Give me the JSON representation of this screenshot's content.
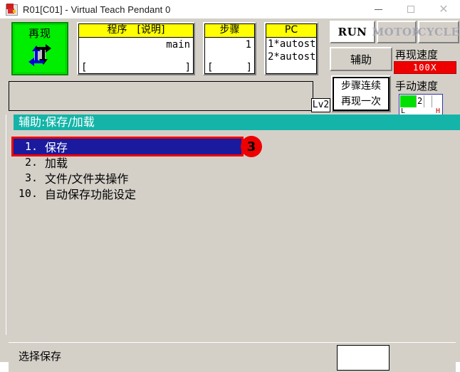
{
  "window": {
    "title": "R01[C01] - Virtual Teach Pendant 0",
    "icon": "app-icon",
    "minimize": "—",
    "maximize": "",
    "close": "✕"
  },
  "mode_button": {
    "label": "再现",
    "icon": "cycle-arrows-icon",
    "color": "#00ee00"
  },
  "panels": [
    {
      "name": "program",
      "header": "程序　[说明]",
      "value": "main",
      "bracket_left": "[",
      "bracket_right": "]"
    },
    {
      "name": "step",
      "header": "步骤",
      "value": "1",
      "bracket_left": "[",
      "bracket_right": "]"
    },
    {
      "name": "pc",
      "header": "PC",
      "line1": "1*autost",
      "line2": "2*autost"
    }
  ],
  "message_bar": {
    "text": "",
    "level_badge": "Lv2"
  },
  "indicators": [
    {
      "label": "RUN",
      "state": "on"
    },
    {
      "label": "MOTOR",
      "state": "off"
    },
    {
      "label": "CYCLE",
      "state": "off"
    }
  ],
  "aux_button": {
    "label": "辅助"
  },
  "step_mode": {
    "line1": "步骤连续",
    "line2": "再现一次"
  },
  "playback_speed": {
    "label": "再现速度",
    "value": "100Ⅹ",
    "color": "#ee0000"
  },
  "manual_speed": {
    "label": "手动速度",
    "level": "2",
    "low": "L",
    "high": "H",
    "bar_color": "#00e000"
  },
  "screen": {
    "title": "辅助:保存/加载",
    "title_color": "#14b4a8",
    "menu": [
      {
        "num": "1.",
        "label": "保存",
        "selected": true
      },
      {
        "num": "2.",
        "label": "加载",
        "selected": false
      },
      {
        "num": "3.",
        "label": "文件/文件夹操作",
        "selected": false
      },
      {
        "num": "10.",
        "label": "自动保存功能设定",
        "selected": false
      }
    ],
    "annotation_badge": "3",
    "selection_outline_color": "#ee0000",
    "selection_fill_color": "#1a1a9e"
  },
  "status_bar": {
    "text": "选择保存",
    "input_value": ""
  }
}
